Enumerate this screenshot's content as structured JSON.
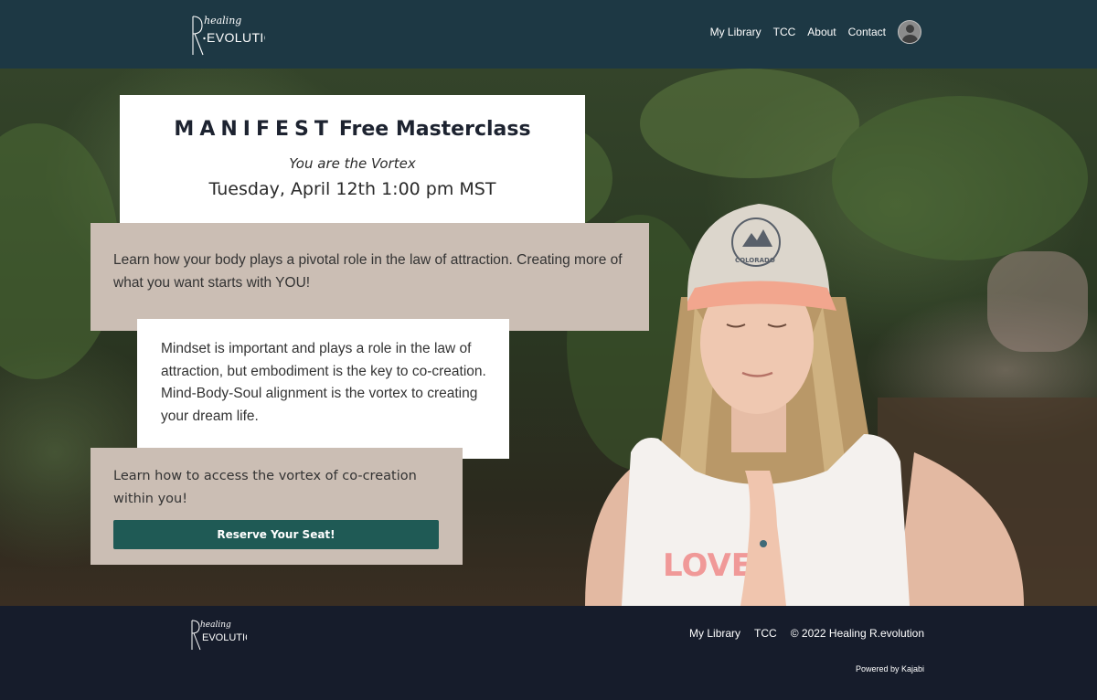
{
  "header": {
    "logo_alt": "Healing R.evolution",
    "nav": [
      "My Library",
      "TCC",
      "About",
      "Contact"
    ]
  },
  "hero": {
    "title_word": "MANIFEST",
    "title_rest": "Free Masterclass",
    "subtitle": "You are the Vortex",
    "date": "Tuesday, April 12th 1:00 pm MST",
    "intro": "Learn how your body plays a pivotal role in the law of attraction. Creating more of what you want starts with YOU!",
    "mindset": "Mindset is important and plays a role in the law of attraction, but embodiment is the key to co-creation. Mind-Body-Soul alignment is the vortex to creating your dream life.",
    "access": "Learn how to access the vortex of co-creation within you!",
    "cta": "Reserve Your Seat!",
    "cap_text": "COLORADO"
  },
  "footer": {
    "links": [
      "My Library",
      "TCC"
    ],
    "copyright": "© 2022 Healing R.evolution",
    "powered": "Powered by Kajabi"
  },
  "colors": {
    "header_bg": "#1d3844",
    "footer_bg": "#161c2b",
    "card_tan": "#cbbeb4",
    "button": "#1f5a55"
  }
}
